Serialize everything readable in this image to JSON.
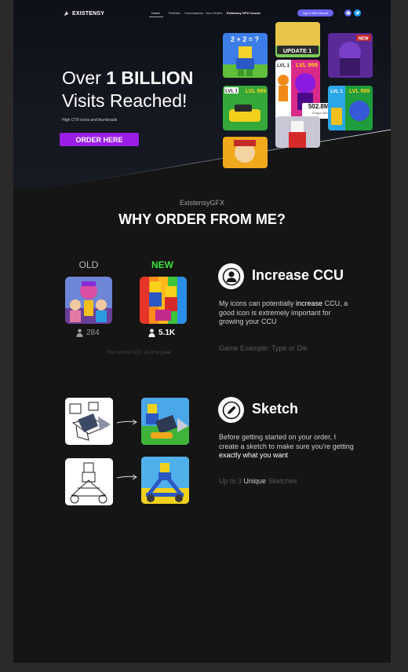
{
  "nav": {
    "brand": "EXISTENSY",
    "links": [
      "Home",
      "Portfolio",
      "Commissions",
      "Your Orders",
      "Existensy GFX Course"
    ],
    "discord_button": "Sign in With Discord"
  },
  "hero": {
    "title_prefix": "Over ",
    "title_bold": "1 BILLION",
    "title_line2": "Visits Reached!",
    "subtitle": "High CTR icons and thumbnails",
    "order_button": "ORDER HERE",
    "stat_number": "502.8M+",
    "stat_label": "Dragon Blox",
    "thumb_texts": {
      "math": "2 + 2 = ?",
      "update": "UPDATE 1",
      "new": "NEW",
      "lvl1": "LVL 1",
      "lvl999": "LVL 999"
    }
  },
  "why": {
    "brand": "ExistensyGFX",
    "heading": "WHY ORDER FROM ME?"
  },
  "ccu": {
    "old_label": "OLD",
    "new_label": "NEW",
    "old_count": "284",
    "new_count": "5.1K",
    "note": "Not current CCU, all-time peak",
    "title": "Increase CCU",
    "desc_1": "My icons can potentially ",
    "desc_hl": "increase",
    "desc_2": " CCU, a good icon is extremely important for growing your CCU",
    "example": "Game Example: Type or Die"
  },
  "sketch": {
    "title": "Sketch",
    "desc_1": "Before getting started on your order, I create a sketch to make sure you're getting ",
    "desc_hl": "exactly what you want",
    "footer_1": "Up to 3 ",
    "footer_hl": "Unique",
    "footer_2": " Sketches"
  },
  "colors": {
    "accent": "#9a1ee6",
    "new_green": "#3fe23f",
    "discord": "#6a64f2",
    "twitter": "#1da1f2"
  }
}
